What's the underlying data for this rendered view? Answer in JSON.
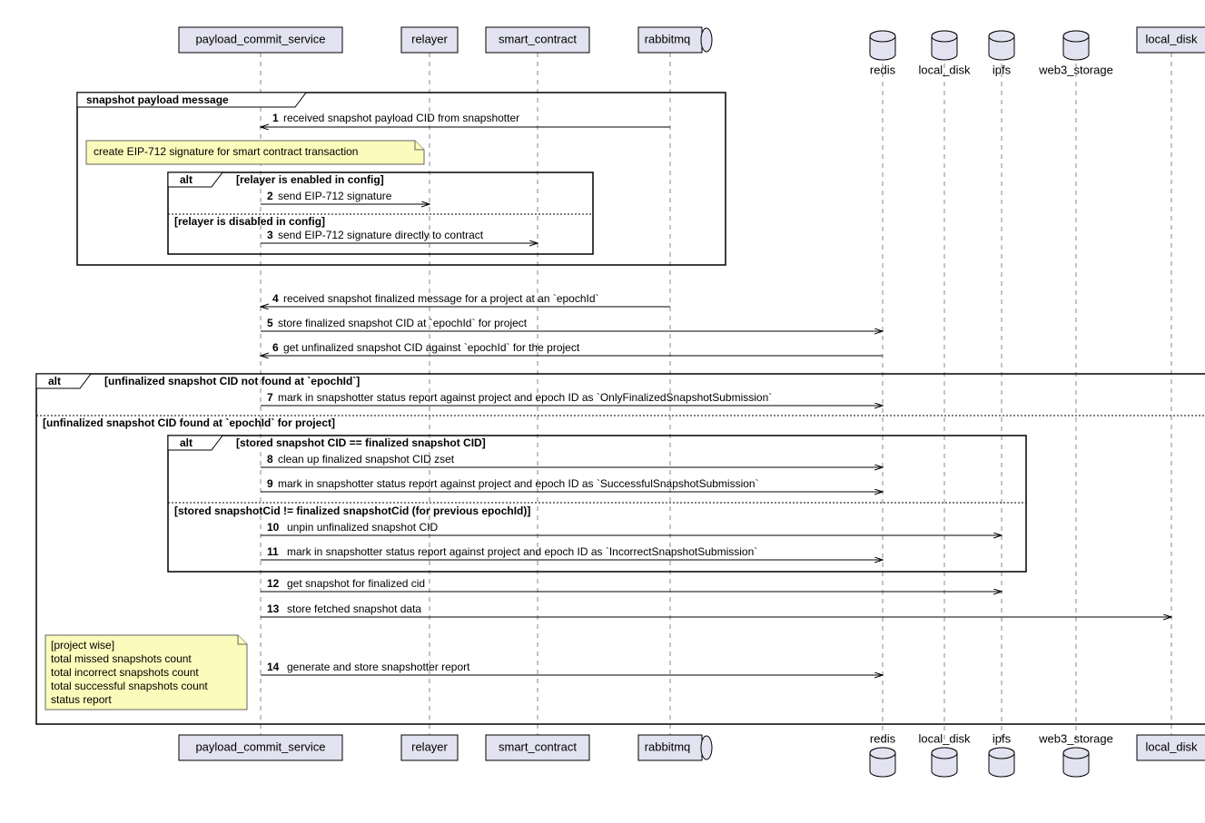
{
  "participants": {
    "p1": "payload_commit_service",
    "p2": "relayer",
    "p3": "smart_contract",
    "p4": "rabbitmq",
    "p5": "redis",
    "p6": "local_disk",
    "p7": "ipfs",
    "p8": "web3_storage",
    "p9": "local_disk"
  },
  "frame1": {
    "label": "snapshot payload message"
  },
  "note1": {
    "text": "create EIP-712 signature for smart contract transaction"
  },
  "alt1": {
    "label": "alt",
    "cond1": "[relayer is enabled in config]",
    "cond2": "[relayer is disabled in config]"
  },
  "alt2": {
    "label": "alt",
    "cond1": "[unfinalized snapshot CID not found at `epochId`]",
    "cond2": "[unfinalized snapshot CID found at `epochId` for project]"
  },
  "alt3": {
    "label": "alt",
    "cond1": "[stored snapshot CID == finalized snapshot CID]",
    "cond2": "[stored snapshotCid != finalized snapshotCid (for previous epochId)]"
  },
  "note2": {
    "line1": "[project wise]",
    "line2": "total missed snapshots count",
    "line3": "total incorrect snapshots count",
    "line4": "total successful snapshots count",
    "line5": "status report"
  },
  "messages": {
    "m1": {
      "num": "1",
      "text": "received snapshot payload CID from snapshotter"
    },
    "m2": {
      "num": "2",
      "text": "send EIP-712 signature"
    },
    "m3": {
      "num": "3",
      "text": "send EIP-712 signature directly to contract"
    },
    "m4": {
      "num": "4",
      "text": "received snapshot finalized message for a project at an `epochId`"
    },
    "m5": {
      "num": "5",
      "text": "store finalized snapshot CID at `epochId` for project"
    },
    "m6": {
      "num": "6",
      "text": "get unfinalized snapshot CID against `epochId` for the project"
    },
    "m7": {
      "num": "7",
      "text": "mark in snapshotter status report against project and epoch ID as `OnlyFinalizedSnapshotSubmission`"
    },
    "m8": {
      "num": "8",
      "text": "clean up finalized snapshot CID zset"
    },
    "m9": {
      "num": "9",
      "text": "mark in snapshotter status report against project and epoch ID as `SuccessfulSnapshotSubmission`"
    },
    "m10": {
      "num": "10",
      "text": "unpin unfinalized snapshot CID"
    },
    "m11": {
      "num": "11",
      "text": "mark in snapshotter status report against project and epoch ID as `IncorrectSnapshotSubmission`"
    },
    "m12": {
      "num": "12",
      "text": "get snapshot for finalized cid"
    },
    "m13": {
      "num": "13",
      "text": "store fetched snapshot data"
    },
    "m14": {
      "num": "14",
      "text": "generate and store snapshotter report"
    }
  }
}
